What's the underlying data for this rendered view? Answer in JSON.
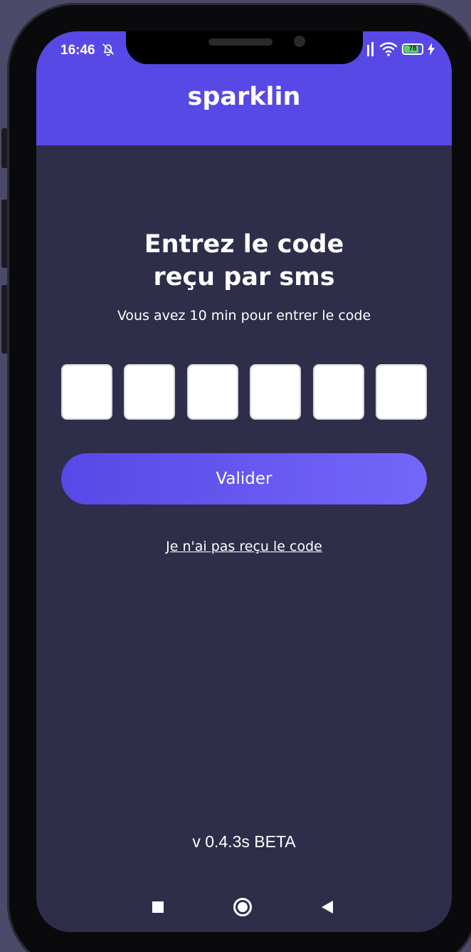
{
  "status_bar": {
    "time": "16:46",
    "battery": "78",
    "icons": [
      "bell-off-icon",
      "signal-icon",
      "wifi-icon",
      "battery-icon",
      "charging-icon"
    ]
  },
  "header": {
    "brand": "sparklin"
  },
  "otp": {
    "title_line1": "Entrez le code",
    "title_line2": "reçu par sms",
    "subtitle": "Vous avez 10 min pour entrer le code",
    "digits": 6
  },
  "actions": {
    "validate_label": "Valider",
    "resend_label": "Je n'ai pas reçu le code"
  },
  "footer": {
    "version": "v 0.4.3s BETA"
  },
  "nav": {
    "icons": [
      "recents-icon",
      "home-icon",
      "back-icon"
    ]
  },
  "colors": {
    "accent": "#5848e6",
    "accent_light": "#7566fa",
    "background": "#2e2e4a",
    "outer": "#4b4b69",
    "text": "#ffffff"
  }
}
